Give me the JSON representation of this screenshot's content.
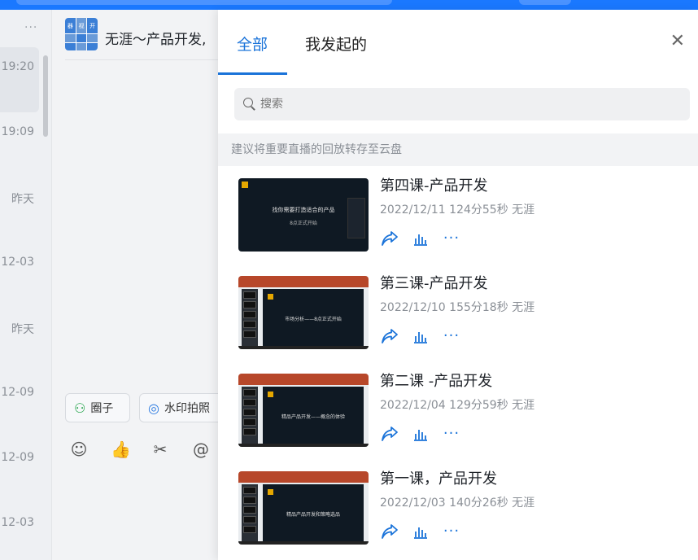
{
  "conv_list": {
    "more_label": "···",
    "items": [
      {
        "time": "19:20",
        "active": true
      },
      {
        "time": "19:09"
      },
      {
        "time": "昨天"
      },
      {
        "time": "12-03"
      },
      {
        "time": "昨天"
      },
      {
        "time": "12-09"
      },
      {
        "time": "12-09"
      },
      {
        "time": "12-03"
      }
    ]
  },
  "chat": {
    "title": "无涯～产品开发,",
    "avatar_chars": [
      "器",
      "视",
      "开",
      "",
      "",
      "",
      "",
      "",
      ""
    ],
    "chips": {
      "circle": "圈子",
      "camera": "水印拍照"
    },
    "toolbar_icons": [
      "smile-icon",
      "thumb-up-icon",
      "scissors-icon",
      "at-icon"
    ]
  },
  "panel": {
    "tabs": {
      "all": "全部",
      "mine": "我发起的"
    },
    "close_label": "✕",
    "search_placeholder": "搜索",
    "notice": "建议将重要直播的回放转存至云盘",
    "records": [
      {
        "title": "第四课-产品开发",
        "date": "2022/12/11",
        "duration": "124分55秒",
        "host": "无涯",
        "thumb_line1": "找你需要打造适合的产品",
        "thumb_line2": "8点正式开始"
      },
      {
        "title": "第三课-产品开发",
        "date": "2022/12/10",
        "duration": "155分18秒",
        "host": "无涯",
        "thumb_line1": "市场分析——8点正式开始"
      },
      {
        "title": "第二课 -产品开发",
        "date": "2022/12/04",
        "duration": "129分59秒",
        "host": "无涯",
        "thumb_line1": "精品产品开发——概念的体验"
      },
      {
        "title": "第一课，产品开发",
        "date": "2022/12/03",
        "duration": "140分26秒",
        "host": "无涯",
        "thumb_line1": "精品产品开发和策略选品"
      }
    ]
  },
  "colors": {
    "accent": "#1a73d9",
    "topbar": "#1a78ff"
  }
}
